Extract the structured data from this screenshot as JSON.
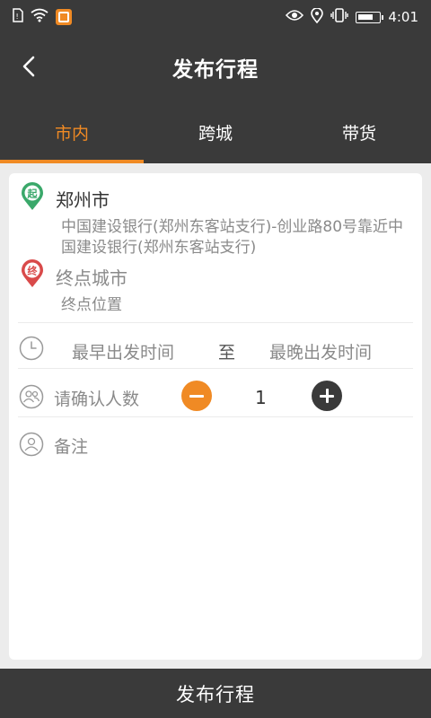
{
  "status_bar": {
    "time": "4:01",
    "left_icons": [
      "sim-icon",
      "wifi-icon",
      "app-notification-icon"
    ],
    "right_icons": [
      "eye-icon",
      "location-icon",
      "vibrate-icon",
      "battery-icon"
    ]
  },
  "header": {
    "title": "发布行程",
    "back_icon": "back-arrow-icon"
  },
  "tabs": [
    {
      "label": "市内",
      "active": true
    },
    {
      "label": "跨城",
      "active": false
    },
    {
      "label": "带货",
      "active": false
    }
  ],
  "route": {
    "start": {
      "badge": "起",
      "city": "郑州市",
      "address": "中国建设银行(郑州东客站支行)-创业路80号靠近中国建设银行(郑州东客站支行)"
    },
    "end": {
      "badge": "终",
      "city_placeholder": "终点城市",
      "address_placeholder": "终点位置"
    }
  },
  "time_row": {
    "earliest_placeholder": "最早出发时间",
    "separator": "至",
    "latest_placeholder": "最晚出发时间"
  },
  "passengers": {
    "label": "请确认人数",
    "count": "1"
  },
  "remark": {
    "placeholder": "备注"
  },
  "submit_button": "发布行程",
  "colors": {
    "accent": "#f08a24",
    "header_bg": "#3a3a3a",
    "start_pin": "#3aa86a",
    "end_pin": "#d94a4a",
    "placeholder_text": "#8a8a8a"
  }
}
